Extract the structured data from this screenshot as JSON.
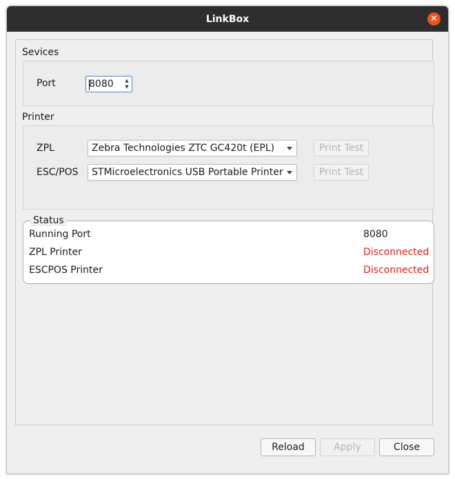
{
  "window": {
    "title": "LinkBox",
    "close_glyph": "✕"
  },
  "services": {
    "section_title": "Sevices",
    "port_label": "Port",
    "port_value": "8080"
  },
  "printer": {
    "section_title": "Printer",
    "zpl": {
      "label": "ZPL",
      "selected": "Zebra Technologies ZTC GC420t (EPL)",
      "test_label": "Print Test"
    },
    "escpos": {
      "label": "ESC/POS",
      "selected": "STMicroelectronics USB Portable Printer",
      "test_label": "Print Test"
    }
  },
  "status": {
    "title": "Status",
    "rows": [
      {
        "label": "Running Port",
        "value": "8080",
        "color": "#1a1a1a"
      },
      {
        "label": "ZPL Printer",
        "value": "Disconnected",
        "color": "#e01b1b"
      },
      {
        "label": "ESCPOS Printer",
        "value": "Disconnected",
        "color": "#e01b1b"
      }
    ]
  },
  "buttons": {
    "reload": "Reload",
    "apply": "Apply",
    "close": "Close"
  },
  "icons": {
    "close": "close-icon",
    "spin_up": "chevron-up-icon",
    "spin_down": "chevron-down-icon",
    "dropdown": "chevron-down-icon"
  },
  "colors": {
    "titlebar": "#2d2d2d",
    "close_button": "#e95420",
    "status_error": "#e01b1b"
  }
}
